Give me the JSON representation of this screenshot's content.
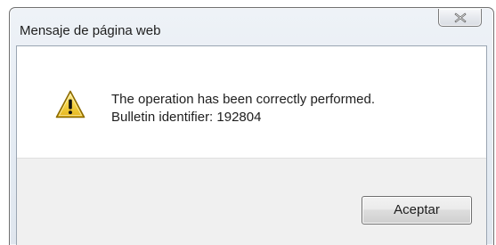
{
  "window": {
    "title": "Mensaje de página web",
    "close_icon": "close-x-icon"
  },
  "message": {
    "icon": "warning-icon",
    "line1": "The operation has been correctly performed.",
    "line2": "Bulletin identifier: 192804"
  },
  "buttons": {
    "ok_label": "Aceptar"
  },
  "colors": {
    "title_bar": "#e4ebf3",
    "button_area": "#f0f0f0",
    "warning_fill": "#f3d34a",
    "warning_border": "#8d6b00"
  }
}
